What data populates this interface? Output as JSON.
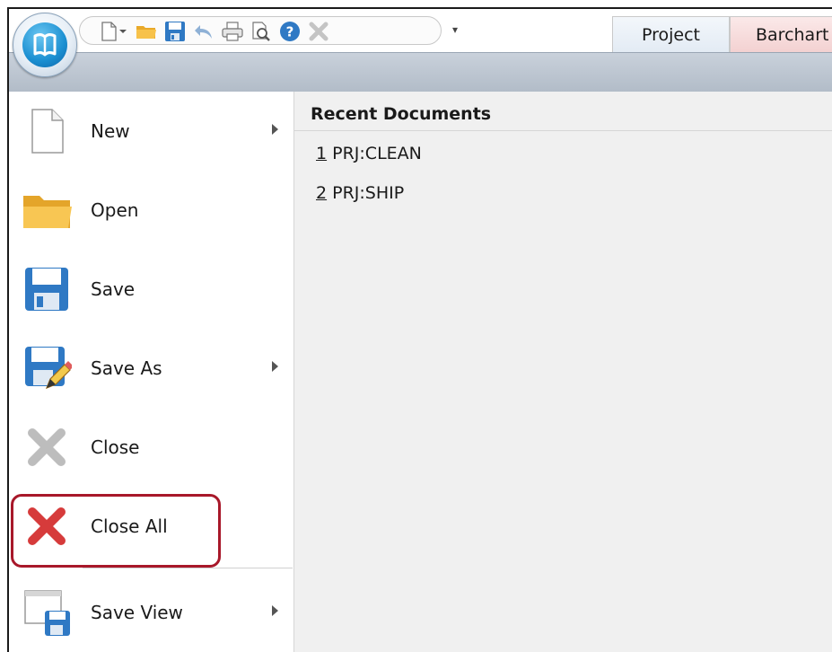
{
  "quick_access": {
    "icons": [
      "new-document-icon",
      "dropdown-icon",
      "open-folder-icon",
      "save-icon",
      "undo-icon",
      "print-icon",
      "print-preview-icon",
      "help-icon",
      "close-icon"
    ],
    "more": "▾"
  },
  "tabs": [
    {
      "label": "Project"
    },
    {
      "label": "Barchart"
    }
  ],
  "menu": {
    "items": [
      {
        "label": "New",
        "icon": "new-document-icon",
        "submenu": true
      },
      {
        "label": "Open",
        "icon": "open-folder-icon",
        "submenu": false
      },
      {
        "label": "Save",
        "icon": "save-icon",
        "submenu": false
      },
      {
        "label": "Save As",
        "icon": "save-as-icon",
        "submenu": true
      },
      {
        "label": "Close",
        "icon": "close-icon",
        "submenu": false
      },
      {
        "label": "Close All",
        "icon": "close-all-icon",
        "submenu": false
      },
      {
        "label": "Save View",
        "icon": "save-view-icon",
        "submenu": true
      }
    ]
  },
  "recent": {
    "title": "Recent Documents",
    "items": [
      {
        "num": "1",
        "name": "PRJ:CLEAN"
      },
      {
        "num": "2",
        "name": "PRJ:SHIP"
      }
    ]
  },
  "colors": {
    "highlight": "#a8182a",
    "accent": "#1b8fd1",
    "close_all_red": "#d63b3b"
  }
}
